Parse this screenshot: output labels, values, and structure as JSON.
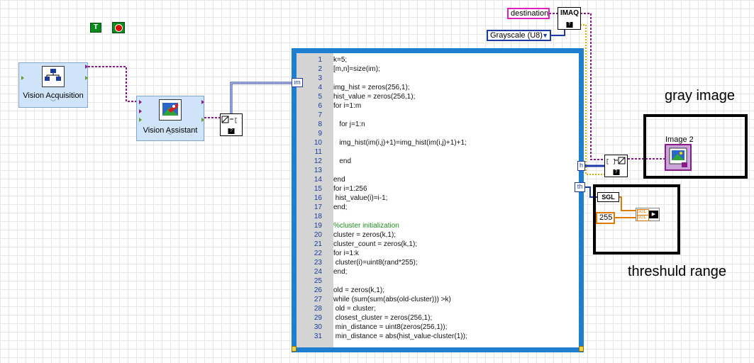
{
  "toolbar_icons": {
    "true_const": "T",
    "stop_icon": "stop-icon"
  },
  "vision_acquisition": {
    "label": "Vision Acquisition"
  },
  "vision_assistant": {
    "label": "Vision Assistant"
  },
  "mathscript": {
    "input_tunnel": "im",
    "output_tunnel_h": "h",
    "output_tunnel_th": "th",
    "lines": [
      {
        "n": "1",
        "t": "k=5;"
      },
      {
        "n": "2",
        "t": "[m,n]=size(im);"
      },
      {
        "n": "3",
        "t": ""
      },
      {
        "n": "4",
        "t": "img_hist = zeros(256,1);"
      },
      {
        "n": "5",
        "t": "hist_value = zeros(256,1);"
      },
      {
        "n": "6",
        "t": "for i=1:m"
      },
      {
        "n": "7",
        "t": ""
      },
      {
        "n": "8",
        "t": "   for j=1:n"
      },
      {
        "n": "9",
        "t": ""
      },
      {
        "n": "10",
        "t": "   img_hist(im(i,j)+1)=img_hist(im(i,j)+1)+1;"
      },
      {
        "n": "11",
        "t": ""
      },
      {
        "n": "12",
        "t": "   end"
      },
      {
        "n": "13",
        "t": ""
      },
      {
        "n": "14",
        "t": "end"
      },
      {
        "n": "15",
        "t": "for i=1:256"
      },
      {
        "n": "16",
        "t": " hist_value(i)=i-1;"
      },
      {
        "n": "17",
        "t": "end;"
      },
      {
        "n": "18",
        "t": ""
      },
      {
        "n": "19",
        "t": "%cluster initialization",
        "c": true
      },
      {
        "n": "20",
        "t": "cluster = zeros(k,1);"
      },
      {
        "n": "21",
        "t": "cluster_count = zeros(k,1);"
      },
      {
        "n": "22",
        "t": "for i=1:k"
      },
      {
        "n": "23",
        "t": " cluster(i)=uint8(rand*255);"
      },
      {
        "n": "24",
        "t": "end;"
      },
      {
        "n": "25",
        "t": ""
      },
      {
        "n": "26",
        "t": "old = zeros(k,1);"
      },
      {
        "n": "27",
        "t": "while (sum(sum(abs(old-cluster))) >k)"
      },
      {
        "n": "28",
        "t": " old = cluster;"
      },
      {
        "n": "29",
        "t": " closest_cluster = zeros(256,1);"
      },
      {
        "n": "30",
        "t": " min_distance = uint8(zeros(256,1));"
      },
      {
        "n": "31",
        "t": " min_distance = abs(hist_value-cluster(1));"
      }
    ]
  },
  "imaq_create": {
    "icon_text": "IMAQ",
    "destination": "destination",
    "image_type": "Grayscale (U8)"
  },
  "image_indicator": {
    "label": "Image 2"
  },
  "gray_image_label": "gray image",
  "threshold": {
    "sgl_label": "SGL",
    "const_value": "255",
    "bundle_labels": [
      "SGL",
      "SGL"
    ],
    "caption": "threshuld range"
  },
  "colors": {
    "image_wire": "#8a1a8a",
    "numeric_wire": "#e07a00",
    "array_wire": "#1c3aa6",
    "mathscript_frame": "#1e7fd0",
    "cluster_wire": "#d6b300"
  }
}
